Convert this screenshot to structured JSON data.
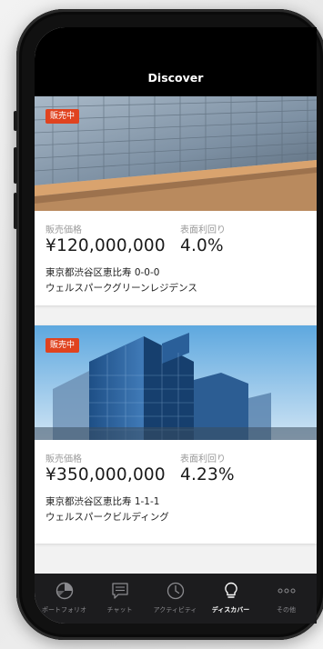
{
  "header": {
    "title": "Discover"
  },
  "listings": [
    {
      "badge": "販売中",
      "price_label": "販売価格",
      "price": "¥120,000,000",
      "yield_label": "表面利回り",
      "yield": "4.0%",
      "address": "東京都渋谷区恵比寿 0-0-0",
      "name": "ウェルスパークグリーンレジデンス"
    },
    {
      "badge": "販売中",
      "price_label": "販売価格",
      "price": "¥350,000,000",
      "yield_label": "表面利回り",
      "yield": "4.23%",
      "address": "東京都渋谷区恵比寿 1-1-1",
      "name": "ウェルスパークビルディング"
    }
  ],
  "tabbar": {
    "items": [
      {
        "label": "ポートフォリオ",
        "icon": "portfolio-icon"
      },
      {
        "label": "チャット",
        "icon": "chat-icon"
      },
      {
        "label": "アクティビティ",
        "icon": "clock-icon"
      },
      {
        "label": "ディスカバー",
        "icon": "lightbulb-icon",
        "active": true
      },
      {
        "label": "その他",
        "icon": "more-icon"
      }
    ]
  },
  "colors": {
    "badge": "#e0431f",
    "header_bg": "#000000",
    "tabbar_bg": "#1c1c1e",
    "tab_inactive": "#8a8a8e",
    "tab_active": "#ffffff"
  }
}
